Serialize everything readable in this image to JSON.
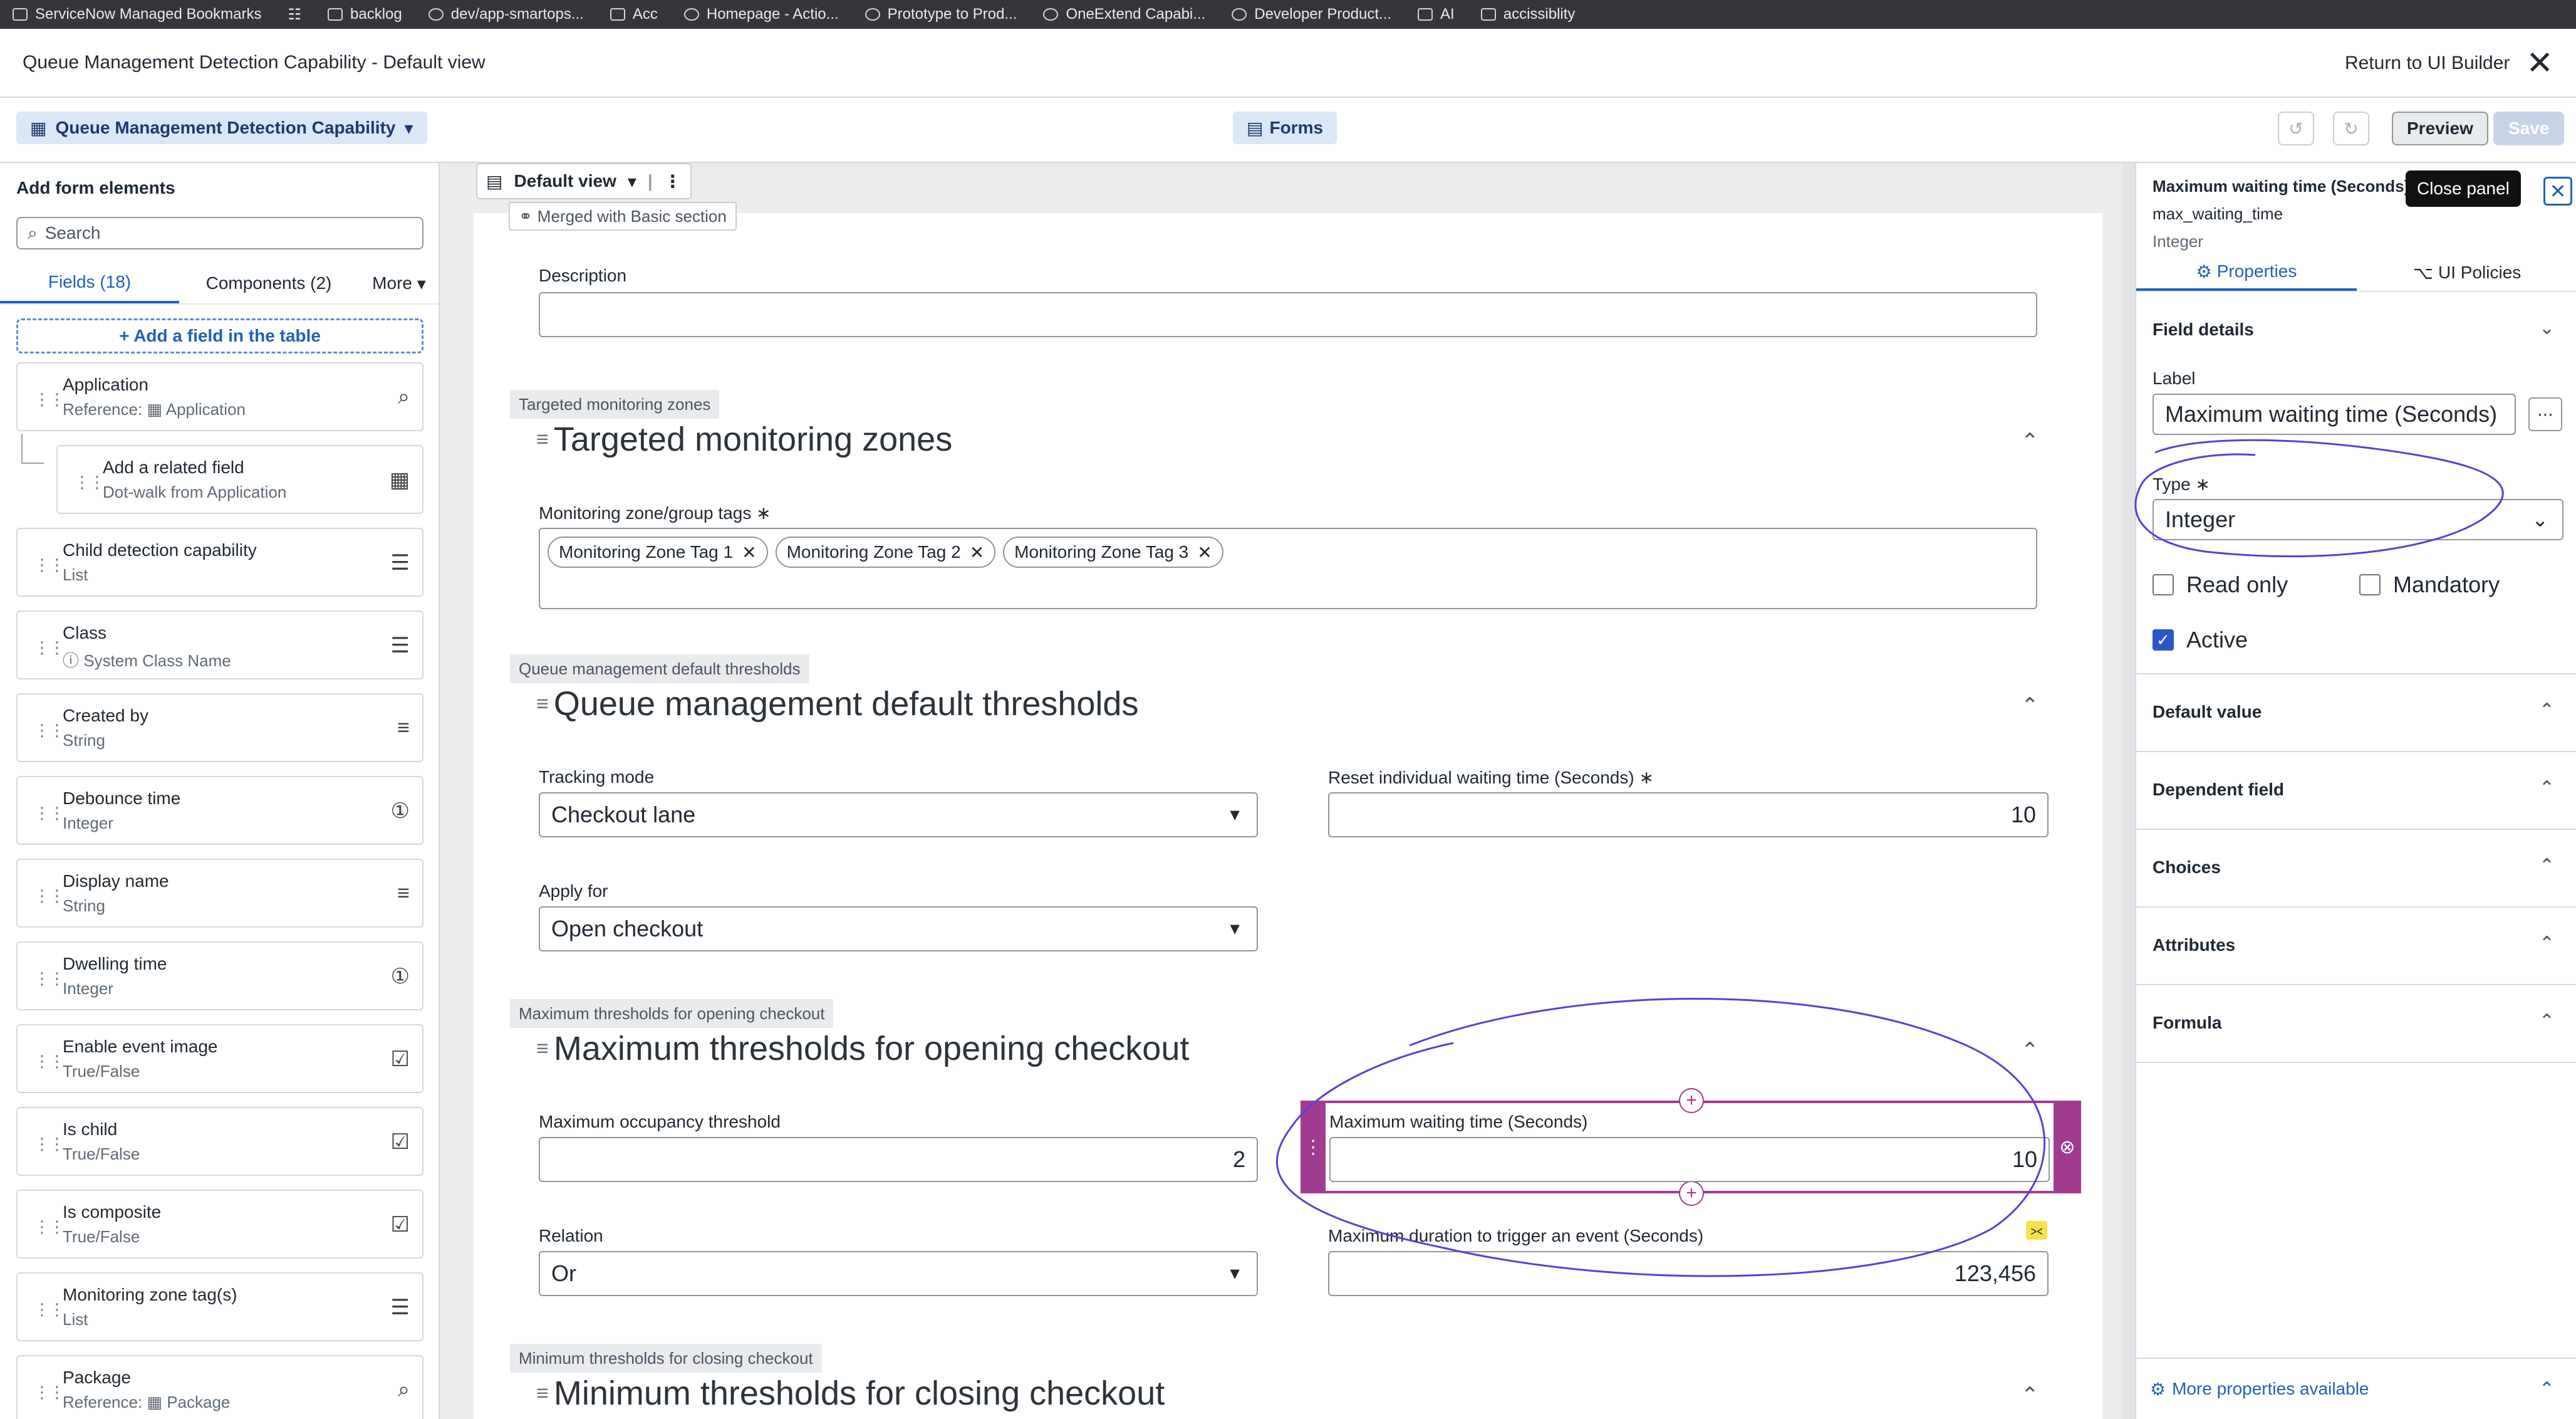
{
  "bookmarks": [
    "ServiceNow Managed Bookmarks",
    "backlog",
    "dev/app-smartops...",
    "Acc",
    "Homepage - Actio...",
    "Prototype to Prod...",
    "OneExtend Capabi...",
    "Developer Product...",
    "AI",
    "accissiblity"
  ],
  "titlebar": {
    "title": "Queue Management Detection Capability - Default view",
    "return_label": "Return to UI Builder"
  },
  "toolbar": {
    "table_name": "Queue Management Detection Capability",
    "forms_label": "Forms",
    "preview_label": "Preview",
    "save_label": "Save"
  },
  "left": {
    "heading": "Add form elements",
    "search_placeholder": "Search",
    "tabs": [
      "Fields (18)",
      "Components (2)",
      "More"
    ],
    "add_field": "+ Add a field in the table",
    "fields": [
      {
        "name": "Application",
        "type": "Reference: ▦ Application",
        "icon": "search-icon"
      },
      {
        "name": "Add a related field",
        "type": "Dot-walk from Application",
        "icon": "table-icon"
      },
      {
        "name": "Child detection capability",
        "type": "List",
        "icon": "list-icon"
      },
      {
        "name": "Class",
        "type": "ⓘ System Class Name",
        "icon": "list-icon"
      },
      {
        "name": "Created by",
        "type": "String",
        "icon": "text-icon"
      },
      {
        "name": "Debounce time",
        "type": "Integer",
        "icon": "integer-icon"
      },
      {
        "name": "Display name",
        "type": "String",
        "icon": "text-icon"
      },
      {
        "name": "Dwelling time",
        "type": "Integer",
        "icon": "integer-icon"
      },
      {
        "name": "Enable event image",
        "type": "True/False",
        "icon": "toggle-icon"
      },
      {
        "name": "Is child",
        "type": "True/False",
        "icon": "toggle-icon"
      },
      {
        "name": "Is composite",
        "type": "True/False",
        "icon": "toggle-icon"
      },
      {
        "name": "Monitoring zone tag(s)",
        "type": "List",
        "icon": "list-icon"
      },
      {
        "name": "Package",
        "type": "Reference: ▦ Package",
        "icon": "search-icon"
      }
    ]
  },
  "canvas": {
    "view_label": "Default view",
    "merged_label": "Merged with Basic section",
    "description_label": "Description",
    "sections": [
      {
        "tag": "Targeted monitoring zones",
        "title": "Targeted monitoring zones"
      },
      {
        "tag": "Queue management default thresholds",
        "title": "Queue management default thresholds"
      },
      {
        "tag": "Maximum thresholds for opening checkout",
        "title": "Maximum thresholds for opening checkout"
      },
      {
        "tag": "Minimum thresholds for closing checkout",
        "title": "Minimum thresholds for closing checkout"
      }
    ],
    "zone_tags_label": "Monitoring zone/group tags ∗",
    "zone_tags": [
      "Monitoring Zone Tag 1",
      "Monitoring Zone Tag 2",
      "Monitoring Zone Tag 3"
    ],
    "tracking_mode": {
      "label": "Tracking mode",
      "value": "Checkout lane"
    },
    "reset_wait": {
      "label": "Reset individual waiting time (Seconds) ∗",
      "value": "10"
    },
    "apply_for": {
      "label": "Apply for",
      "value": "Open checkout"
    },
    "max_occupancy": {
      "label": "Maximum occupancy threshold",
      "value": "2"
    },
    "max_wait": {
      "label": "Maximum waiting time (Seconds)",
      "value": "10"
    },
    "relation": {
      "label": "Relation",
      "value": "Or"
    },
    "max_duration": {
      "label": "Maximum duration to trigger an event (Seconds)",
      "value": "123,456"
    }
  },
  "right": {
    "title": "Maximum waiting time (Seconds)",
    "field_name": "max_waiting_time",
    "field_type": "Integer",
    "tooltip": "Close panel",
    "tabs": [
      "Properties",
      "UI Policies"
    ],
    "field_details": "Field details",
    "label_label": "Label",
    "label_value": "Maximum waiting time (Seconds)",
    "type_label": "Type ∗",
    "type_value": "Integer",
    "read_only": "Read only",
    "mandatory": "Mandatory",
    "active": "Active",
    "accordions": [
      "Default value",
      "Dependent field",
      "Choices",
      "Attributes",
      "Formula"
    ],
    "more_properties": "More properties available"
  },
  "colors": {
    "accent": "#2460b9",
    "selection": "#a03b8f",
    "annotation": "#5a3fd8"
  }
}
